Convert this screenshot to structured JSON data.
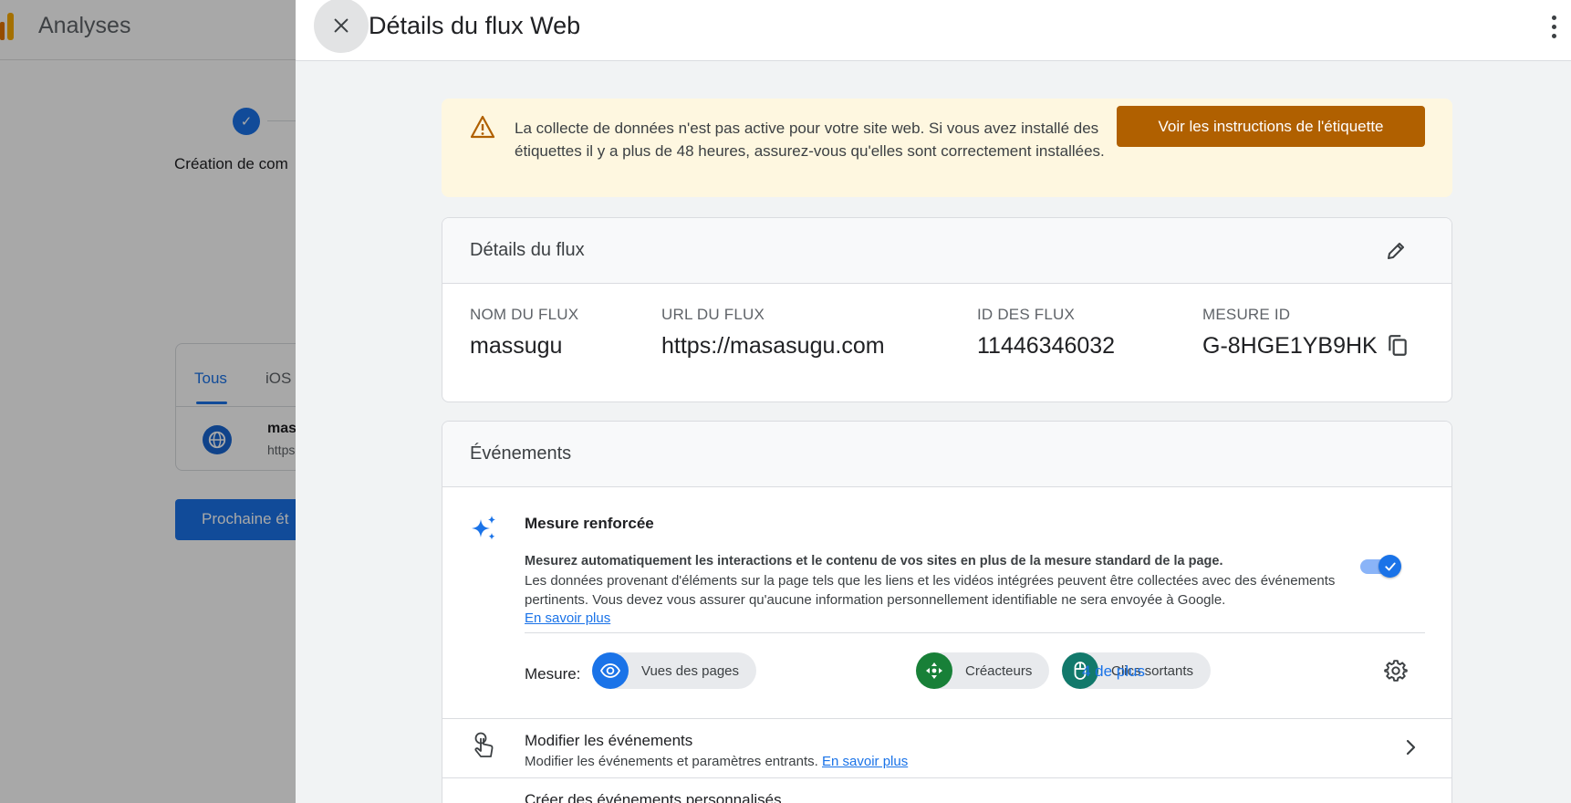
{
  "app": {
    "title": "Analyses"
  },
  "background": {
    "step_label": "Création de com",
    "tabs": [
      "Tous",
      "iOS"
    ],
    "stream_row": {
      "name": "mas",
      "url": "https:"
    },
    "next_button": "Prochaine ét"
  },
  "panel": {
    "title": "Détails du flux Web",
    "warning": {
      "text": "La collecte de données n'est pas active pour votre site web. Si vous avez installé des étiquettes il y a plus de 48 heures, assurez-vous qu'elles sont correctement installées.",
      "button": "Voir les instructions de l'étiquette"
    },
    "details": {
      "header": "Détails du flux",
      "columns": [
        {
          "label": "NOM DU FLUX",
          "value": "massugu"
        },
        {
          "label": "URL DU FLUX",
          "value": "https://masasugu.com"
        },
        {
          "label": "ID DES FLUX",
          "value": "11446346032"
        },
        {
          "label": "MESURE ID",
          "value": "G-8HGE1YB9HK"
        }
      ]
    },
    "events": {
      "header": "Événements",
      "enhanced": {
        "title": "Mesure renforcée",
        "bold_line": "Mesurez automatiquement les interactions et le contenu de vos sites en plus de la mesure standard de la page.",
        "description": "Les données provenant d'éléments sur la page tels que les liens et les vidéos intégrées peuvent être collectées avec des événements pertinents. Vous devez vous assurer qu'aucune information personnellement identifiable ne sera envoyée à Google.",
        "learn_more": "En savoir plus",
        "toggle_on": true,
        "measure_label": "Mesure:",
        "chips": [
          {
            "label": "Vues des pages",
            "icon": "eye-icon",
            "color": "#1a73e8"
          },
          {
            "label": "Créacteurs",
            "icon": "scroll-icon",
            "color": "#188038"
          },
          {
            "label": "Clics sortants",
            "icon": "mouse-icon",
            "color": "#12796b"
          }
        ],
        "more_link": "4 de plus"
      },
      "modify": {
        "title": "Modifier les événements",
        "description": "Modifier les événements et paramètres entrants.",
        "learn_more": "En savoir plus"
      },
      "next_row_title": "Créer des événements personnalisés"
    }
  }
}
